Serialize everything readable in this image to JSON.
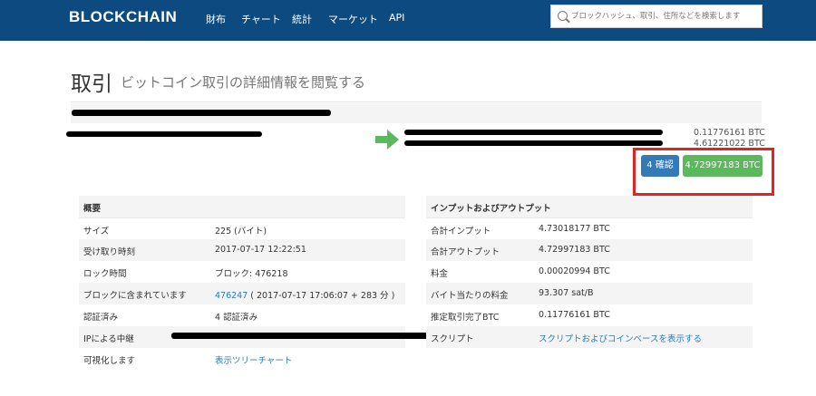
{
  "nav": {
    "logo": "BLOCKCHAIN",
    "links": [
      "財布",
      "チャート",
      "統計",
      "マーケット",
      "API"
    ],
    "search_placeholder": "ブロックハッシュ、取引、住所などを検索します"
  },
  "page": {
    "title": "取引",
    "subtitle": "ビットコイン取引の詳細情報を閲覧する"
  },
  "transaction": {
    "outputs": [
      "0.11776161 BTC",
      "4.61221022 BTC"
    ],
    "confirmations_button": "4 確認",
    "total_button": "4.72997183 BTC"
  },
  "summary": {
    "header": "概要",
    "rows": [
      {
        "label": "サイズ",
        "value": "225 (バイト)"
      },
      {
        "label": "受け取り時刻",
        "value": "2017-07-17 12:22:51"
      },
      {
        "label": "ロック時間",
        "value": "ブロック: 476218"
      },
      {
        "label": "ブロックに含まれています",
        "value_link": "476247",
        "value": " ( 2017-07-17 17:06:07 + 283 分 )"
      },
      {
        "label": "認証済み",
        "value": "4 認証済み"
      },
      {
        "label": "IPによる中継",
        "value": ""
      },
      {
        "label": "可視化します",
        "value_link": "表示ツリーチャート"
      }
    ]
  },
  "io": {
    "header": "インプットおよびアウトプット",
    "rows": [
      {
        "label": "合計インプット",
        "value": "4.73018177 BTC"
      },
      {
        "label": "合計アウトプット",
        "value": "4.72997183 BTC"
      },
      {
        "label": "料金",
        "value": "0.00020994 BTC"
      },
      {
        "label": "バイト当たりの料金",
        "value": "93.307 sat/B"
      },
      {
        "label": "推定取引完了BTC",
        "value": "0.11776161 BTC"
      },
      {
        "label": "スクリプト",
        "value_link": "スクリプトおよびコインベースを表示する"
      }
    ]
  }
}
